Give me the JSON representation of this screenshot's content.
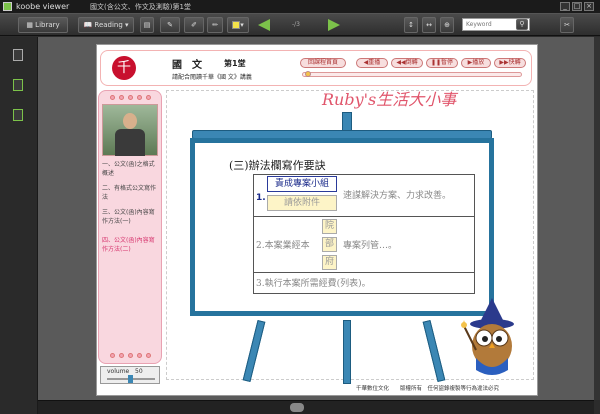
{
  "app": {
    "name": "koobe viewer",
    "doc_title": "國文(含公文、作文及測驗)第1堂"
  },
  "toolbar": {
    "library_label": "Library",
    "reading_label": "Reading",
    "page_indicator": "-/3",
    "search_value": "Keyword"
  },
  "lesson": {
    "subject": "國　文",
    "session": "第1堂",
    "subtitle": "請配合閱讀千華《國 文》講義",
    "buttons": [
      "回課程首頁",
      "重播",
      "倒轉",
      "暫停",
      "播放",
      "快轉"
    ]
  },
  "sidebar": {
    "items": [
      "一、公文(函)之格式概述",
      "二、有格式公文寫作法",
      "三、公文(函)內容寫作方法(一)",
      "四、公文(函)內容寫作方法(二)"
    ],
    "volume_label": "volume",
    "volume_value": 50
  },
  "watermark": "Ruby's生活大小事",
  "board": {
    "heading": "(三)辦法欄寫作要訣",
    "row1_num": "1.",
    "row1_box1": "責成專案小組",
    "row1_box2": "請依附件",
    "row1_text": "速謀解決方案、力求改善。",
    "row2_prefix": "2.本案業經本",
    "row2_char1": "院",
    "row2_char2": "部",
    "row2_char3": "府",
    "row2_text": "專案列管…。",
    "row3_text": "3.執行本案所需經費(列表)。"
  },
  "footer": "千華數位文化　　版權所有　任何盜錄複製等行為違法必究",
  "colors": {
    "accent": "#26739d",
    "brand_red": "#c8102e",
    "pink_panel": "#f9d7df"
  }
}
